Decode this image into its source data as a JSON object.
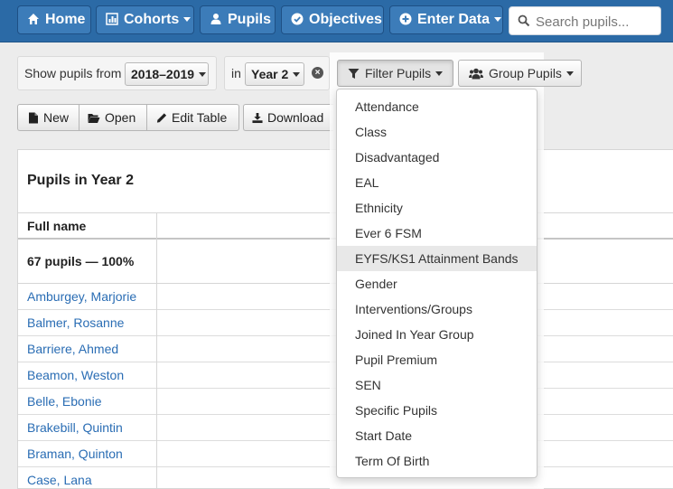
{
  "nav": {
    "home": "Home",
    "cohorts": "Cohorts",
    "pupils": "Pupils",
    "objectives": "Objectives",
    "enter_data": "Enter Data",
    "search_placeholder": "Search pupils..."
  },
  "filter_bar": {
    "show_from_label": "Show pupils from",
    "year_range": "2018–2019",
    "in_label": "in",
    "year_group": "Year 2",
    "filter_button": "Filter Pupils",
    "group_button": "Group Pupils"
  },
  "toolbar": {
    "new": "New",
    "open": "Open",
    "edit_table": "Edit Table",
    "download": "Download"
  },
  "table": {
    "caption": "Pupils in Year 2",
    "column_full_name": "Full name",
    "summary": "67 pupils — 100%",
    "rows": [
      "Amburgey, Marjorie",
      "Balmer, Rosanne",
      "Barriere, Ahmed",
      "Beamon, Weston",
      "Belle, Ebonie",
      "Brakebill, Quintin",
      "Braman, Quinton",
      "Case, Lana"
    ]
  },
  "filter_menu": {
    "items": [
      "Attendance",
      "Class",
      "Disadvantaged",
      "EAL",
      "Ethnicity",
      "Ever 6 FSM",
      "EYFS/KS1 Attainment Bands",
      "Gender",
      "Interventions/Groups",
      "Joined In Year Group",
      "Pupil Premium",
      "SEN",
      "Specific Pupils",
      "Start Date",
      "Term Of Birth"
    ],
    "highlighted": "EYFS/KS1 Attainment Bands"
  },
  "colors": {
    "navbar": "#2b6aa6",
    "link": "#2a6db4"
  }
}
